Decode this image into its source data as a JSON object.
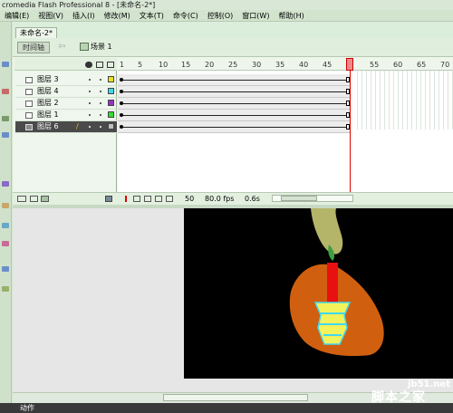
{
  "window": {
    "title": "cromedia Flash Professional 8 - [未命名-2*]"
  },
  "menu": [
    "编辑(E)",
    "视图(V)",
    "插入(I)",
    "修改(M)",
    "文本(T)",
    "命令(C)",
    "控制(O)",
    "窗口(W)",
    "帮助(H)"
  ],
  "document_tab": "未命名-2*",
  "toolbar": {
    "timeline_button": "时间轴",
    "scene_label": "场景 1"
  },
  "timeline": {
    "ruler_numbers": [
      "1",
      "5",
      "10",
      "15",
      "20",
      "25",
      "30",
      "35",
      "40",
      "45",
      "50",
      "55",
      "60",
      "65",
      "70"
    ],
    "layers": [
      {
        "name": "图层 3",
        "color": "#f0e020"
      },
      {
        "name": "图层 4",
        "color": "#40d8f0"
      },
      {
        "name": "图层 2",
        "color": "#9a30c8"
      },
      {
        "name": "图层 1",
        "color": "#30e030"
      },
      {
        "name": "图层 6",
        "color": "#c0c0c0",
        "selected": true
      }
    ],
    "current_frame": "50",
    "fps": "80.0 fps",
    "elapsed": "0.6s"
  },
  "bottom_panel": {
    "label": "动作"
  },
  "watermark": {
    "site": "jb51.net",
    "name": "脚本之家"
  }
}
